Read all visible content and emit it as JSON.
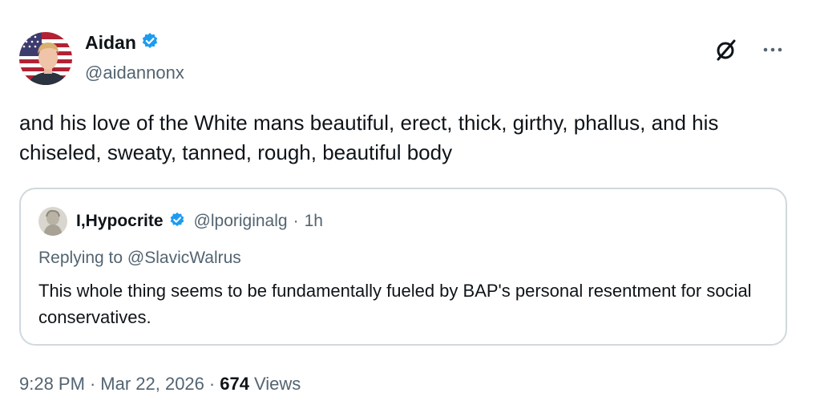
{
  "author": {
    "name": "Aidan",
    "handle": "@aidannonx",
    "verified": true,
    "avatar_icon": "profile-photo-us-flag"
  },
  "icons": {
    "verified": "verified-badge-icon",
    "grok": "grok-icon",
    "more": "more-options-icon",
    "verified_color": "#1d9bf0"
  },
  "tweet": {
    "text": "and his love of the White mans beautiful, erect, thick, girthy, phallus, and his chiseled, sweaty, tanned, rough, beautiful body"
  },
  "quote": {
    "name": "I,Hypocrite",
    "handle": "@lporiginalg",
    "separator": "·",
    "time": "1h",
    "replying_to": "Replying to @SlavicWalrus",
    "text": "This whole thing seems to be fundamentally fueled by BAP's personal resentment for social conservatives."
  },
  "footer": {
    "time": "9:28 PM",
    "sep1": "·",
    "date": "Mar 22, 2026",
    "sep2": "·",
    "views_count": "674",
    "views_label": "Views"
  },
  "colors": {
    "text": "#0f1419",
    "muted": "#536471",
    "border": "#cfd9de",
    "accent": "#1d9bf0"
  }
}
